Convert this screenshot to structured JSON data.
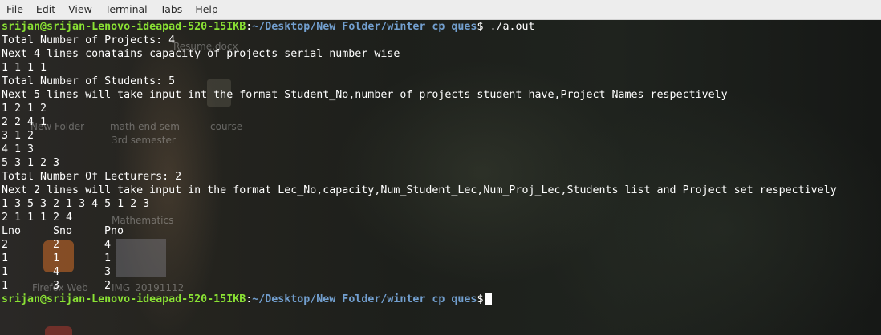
{
  "menubar": {
    "items": [
      "File",
      "Edit",
      "View",
      "Terminal",
      "Tabs",
      "Help"
    ]
  },
  "desktop_ghosts": {
    "resume": "Resume.docx",
    "new_folder": "New Folder",
    "math_end_sem": "math end sem",
    "third_semester": "3rd semester",
    "course": "course",
    "mathematics": "Mathematics",
    "firefox_web": "Firefox Web",
    "img": "IMG_20191112"
  },
  "terminal": {
    "prompt_user": "srijan@srijan-Lenovo-ideapad-520-15IKB",
    "prompt_path": "~/Desktop/New Folder/winter cp ques",
    "command": "./a.out",
    "output_lines": [
      "Total Number of Projects: 4",
      "Next 4 lines conatains capacity of projects serial number wise",
      "1 1 1 1",
      "Total Number of Students: 5",
      "Next 5 lines will take input int the format Student_No,number of projects student have,Project Names respectively",
      "1 2 1 2",
      "2 2 4 1",
      "3 1 2",
      "4 1 3",
      "5 3 1 2 3",
      "Total Number Of Lecturers: 2",
      "Next 2 lines will take input in the format Lec_No,capacity,Num_Student_Lec,Num_Proj_Lec,Students list and Project set respectively",
      "1 3 5 3 2 1 3 4 5 1 2 3",
      "2 1 1 1 2 4"
    ],
    "table": {
      "headers": [
        "Lno",
        "Sno",
        "Pno"
      ],
      "rows": [
        [
          "2",
          "2",
          "4"
        ],
        [
          "1",
          "1",
          "1"
        ],
        [
          "1",
          "4",
          "3"
        ],
        [
          "1",
          "3",
          "2"
        ]
      ]
    },
    "colors": {
      "user": "#8ae234",
      "path": "#729fcf",
      "text": "#ffffff"
    }
  }
}
